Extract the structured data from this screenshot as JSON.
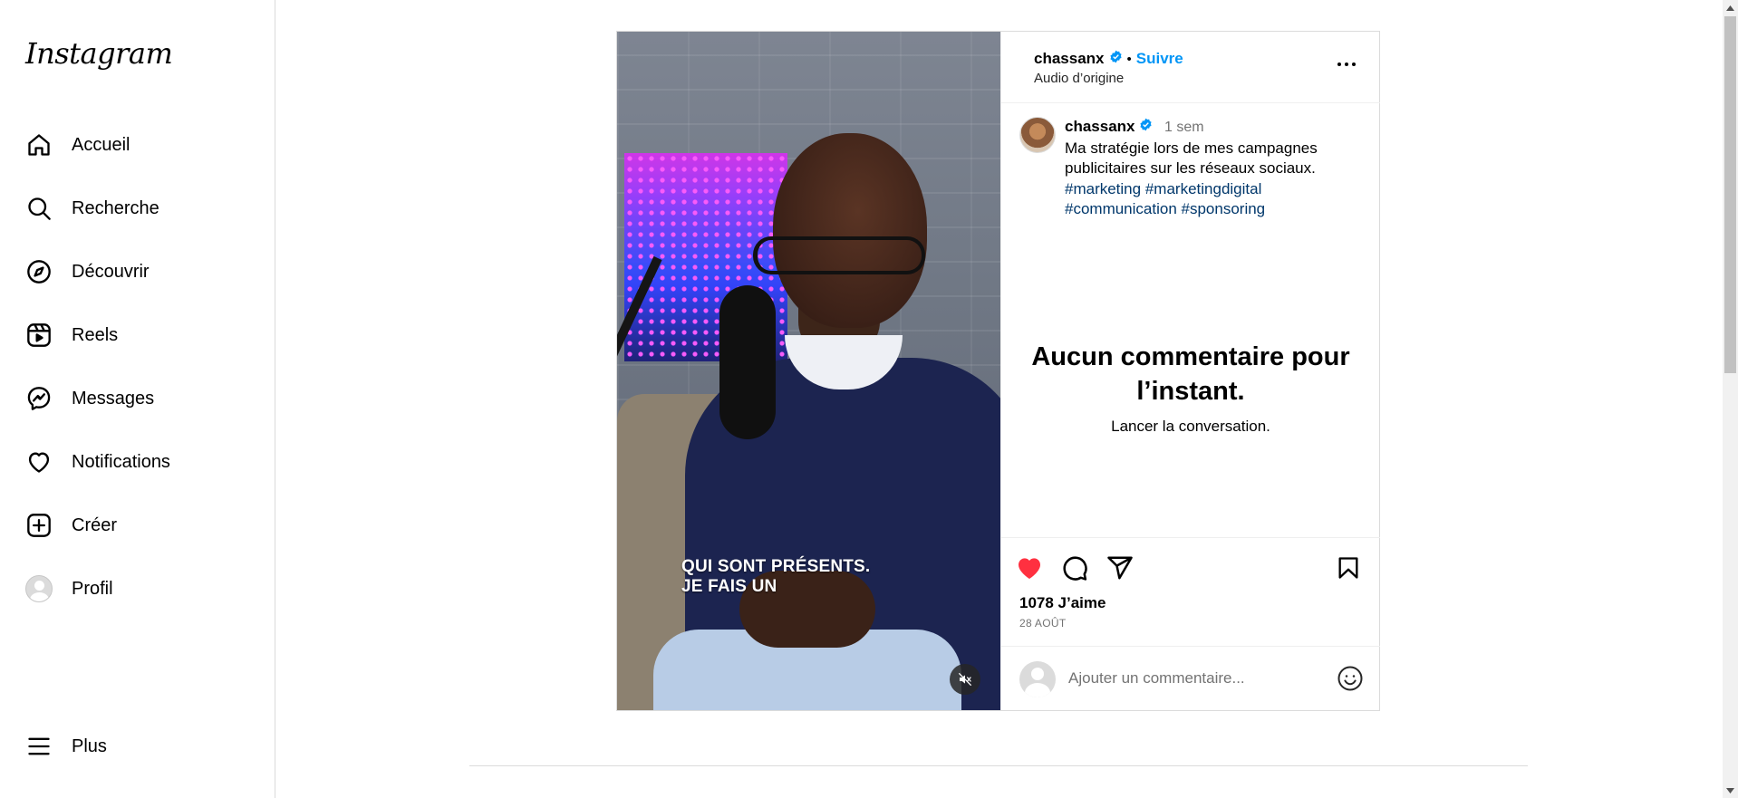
{
  "sidebar": {
    "logo": "Instagram",
    "items": [
      {
        "label": "Accueil",
        "icon": "home-icon"
      },
      {
        "label": "Recherche",
        "icon": "search-icon"
      },
      {
        "label": "Découvrir",
        "icon": "compass-icon"
      },
      {
        "label": "Reels",
        "icon": "reels-icon"
      },
      {
        "label": "Messages",
        "icon": "messenger-icon"
      },
      {
        "label": "Notifications",
        "icon": "heart-icon"
      },
      {
        "label": "Créer",
        "icon": "plus-square-icon"
      },
      {
        "label": "Profil",
        "icon": "avatar"
      }
    ],
    "more": {
      "label": "Plus",
      "icon": "menu-icon"
    }
  },
  "post": {
    "username": "chassanx",
    "separator": "•",
    "follow_label": "Suivre",
    "audio": "Audio d’origine",
    "caption": {
      "username": "chassanx",
      "time": "1 sem",
      "text": "Ma stratégie lors de mes campagnes publicitaires sur les réseaux sociaux.",
      "tags": [
        "#marketing",
        "#marketingdigital",
        "#communication",
        "#sponsoring"
      ]
    },
    "video_subtitle_line1": "QUI SONT PRÉSENTS.",
    "video_subtitle_line2": "JE FAIS UN",
    "empty_title": "Aucun commentaire pour l’instant.",
    "empty_subtitle": "Lancer la conversation.",
    "likes": "1078 J’aime",
    "date": "28 AOÛT",
    "comment_placeholder": "Ajouter un commentaire...",
    "liked": true
  },
  "colors": {
    "accent": "#0095f6",
    "like": "#ff3040",
    "hashtag": "#00376b",
    "muted": "#737373",
    "border": "#dbdbdb"
  }
}
